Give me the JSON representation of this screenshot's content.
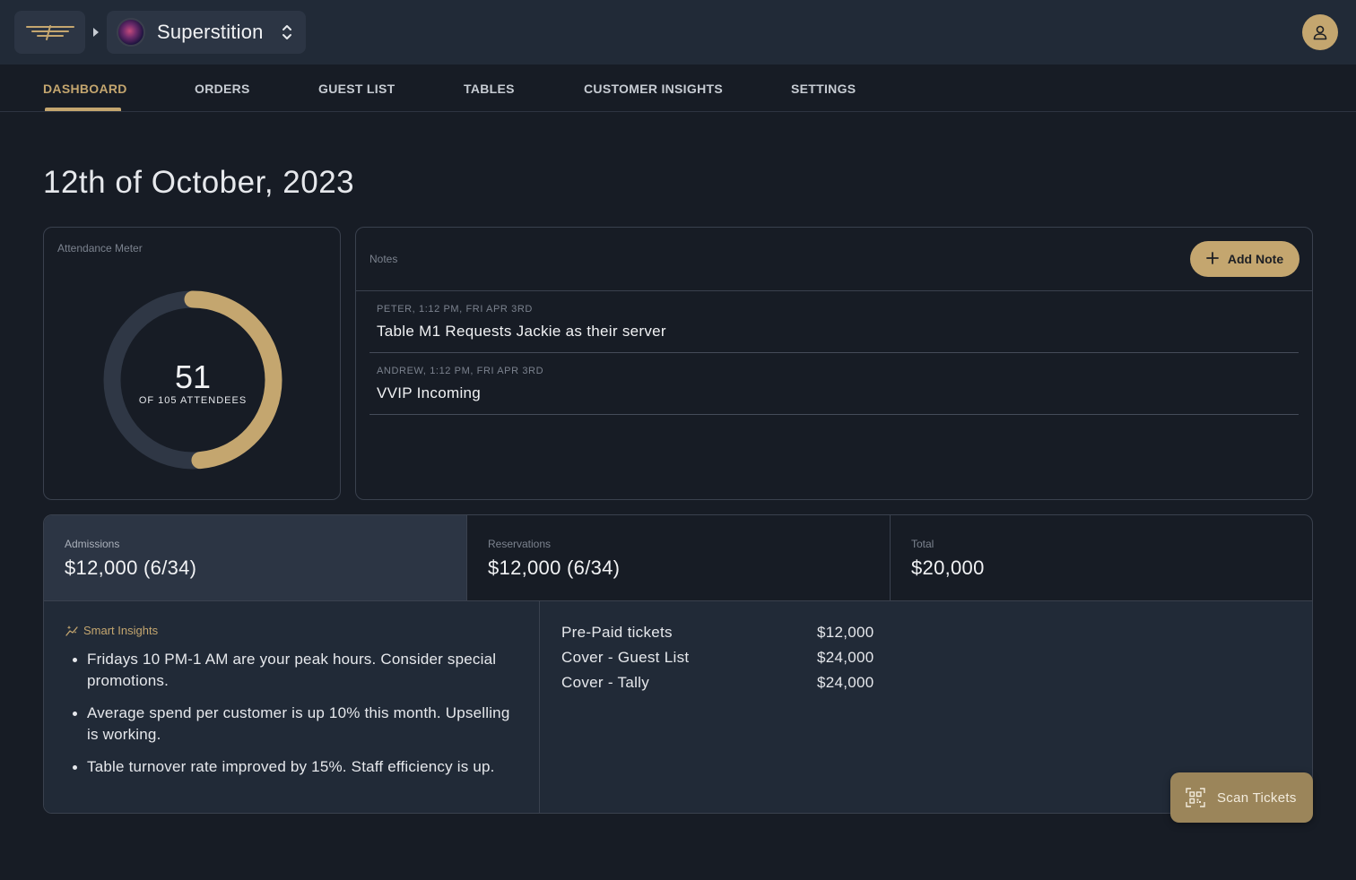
{
  "header": {
    "venue_name": "Superstition"
  },
  "tabs": [
    {
      "label": "DASHBOARD",
      "active": true
    },
    {
      "label": "ORDERS"
    },
    {
      "label": "GUEST LIST"
    },
    {
      "label": "TABLES"
    },
    {
      "label": "CUSTOMER INSIGHTS"
    },
    {
      "label": "SETTINGS"
    }
  ],
  "page": {
    "date_title": "12th of October, 2023"
  },
  "attendance": {
    "label": "Attendance Meter",
    "current": "51",
    "subtitle": "OF 105 ATTENDEES",
    "fraction": 0.4857,
    "colors": {
      "track": "#2f3745",
      "fill": "#c4a66f"
    }
  },
  "notes": {
    "label": "Notes",
    "add_button": "Add Note",
    "items": [
      {
        "meta": "PETER, 1:12 PM, FRI APR 3RD",
        "text": "Table M1 Requests Jackie as their server"
      },
      {
        "meta": "ANDREW, 1:12 PM, FRI APR 3RD",
        "text": "VVIP Incoming"
      }
    ]
  },
  "stats": [
    {
      "label": "Admissions",
      "value": "$12,000 (6/34)"
    },
    {
      "label": "Reservations",
      "value": "$12,000 (6/34)"
    },
    {
      "label": "Total",
      "value": "$20,000"
    }
  ],
  "insights": {
    "title": "Smart Insights",
    "items": [
      "Fridays 10 PM-1 AM are your peak hours. Consider special promotions.",
      "Average spend per customer is up 10% this month. Upselling is working.",
      "Table turnover rate improved by 15%. Staff efficiency is up."
    ]
  },
  "breakdown": [
    {
      "label": "Pre-Paid tickets",
      "value": "$12,000"
    },
    {
      "label": "Cover - Guest List",
      "value": "$24,000"
    },
    {
      "label": "Cover - Tally",
      "value": "$24,000"
    }
  ],
  "scan": {
    "label": "Scan Tickets"
  },
  "icons": {
    "logo": "winged-logo-icon",
    "caret": "caret-right-icon",
    "chevrons": "chevron-up-down-icon",
    "user": "user-icon",
    "plus": "plus-icon",
    "sparkle": "sparkle-icon",
    "qr": "qr-code-icon"
  },
  "colors": {
    "accent": "#c4a66f",
    "background": "#171c25",
    "topbar": "#212a37"
  }
}
